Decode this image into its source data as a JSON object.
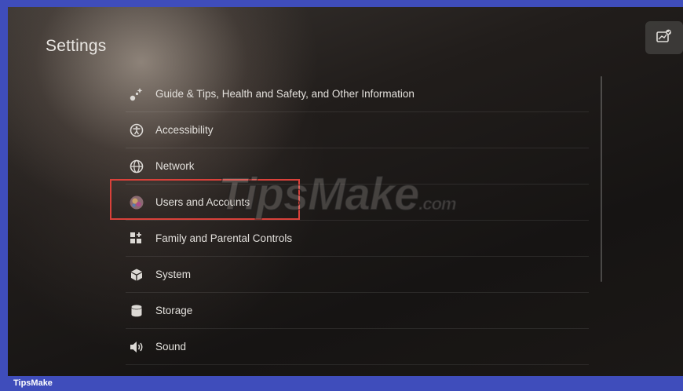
{
  "screen": {
    "title": "Settings",
    "corner_button_icon": "screenshot-gallery-icon"
  },
  "menu": {
    "items": [
      {
        "label": "Guide & Tips, Health and Safety, and Other Information",
        "icon": "tips-sparkle-icon"
      },
      {
        "label": "Accessibility",
        "icon": "accessibility-icon"
      },
      {
        "label": "Network",
        "icon": "globe-icon"
      },
      {
        "label": "Users and Accounts",
        "icon": "user-avatar-icon",
        "highlighted": true
      },
      {
        "label": "Family and Parental Controls",
        "icon": "family-controls-icon"
      },
      {
        "label": "System",
        "icon": "system-cube-icon"
      },
      {
        "label": "Storage",
        "icon": "storage-cylinder-icon"
      },
      {
        "label": "Sound",
        "icon": "speaker-icon"
      },
      {
        "label": "",
        "icon": "display-icon"
      }
    ]
  },
  "watermark": {
    "text": "TipsMake",
    "suffix": ".com"
  },
  "footer": {
    "text": "TipsMake"
  },
  "colors": {
    "highlight": "#d9413a",
    "footer_bar": "#3f4dbb"
  }
}
